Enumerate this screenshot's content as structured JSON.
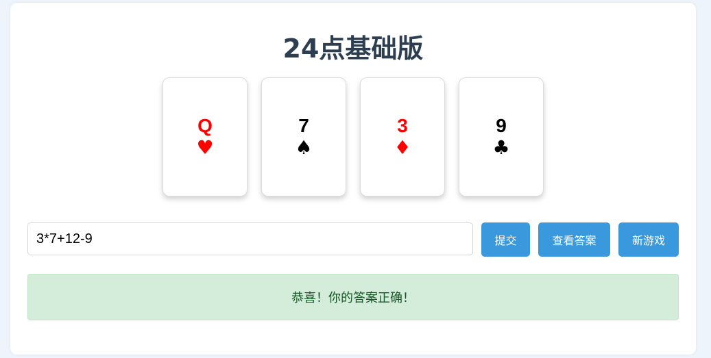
{
  "title": "24点基础版",
  "cards": [
    {
      "rank": "Q",
      "suit": "♥",
      "color": "#ff0000"
    },
    {
      "rank": "7",
      "suit": "♠",
      "color": "#000000"
    },
    {
      "rank": "3",
      "suit": "♦",
      "color": "#ff0000"
    },
    {
      "rank": "9",
      "suit": "♣",
      "color": "#000000"
    }
  ],
  "input": {
    "value": "3*7+12-9",
    "placeholder": ""
  },
  "buttons": {
    "submit": "提交",
    "show_answer": "查看答案",
    "new_game": "新游戏"
  },
  "result": {
    "message": "恭喜！你的答案正确！"
  },
  "colors": {
    "accent": "#3a98dc",
    "success_bg": "#d4edda",
    "success_text": "#155724",
    "title": "#2c3e50"
  }
}
